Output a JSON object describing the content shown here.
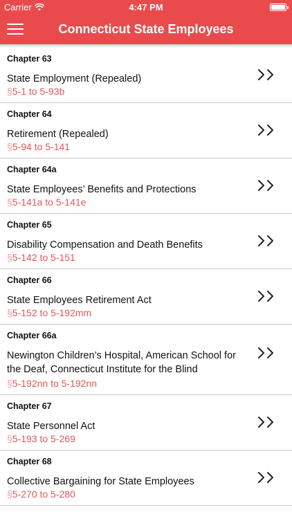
{
  "status_bar": {
    "carrier": "Carrier",
    "time": "4:47 PM"
  },
  "nav": {
    "title": "Connecticut State Employees",
    "menu_icon": "hamburger-menu-icon"
  },
  "colors": {
    "header_bg": "#e94b4d",
    "range_text": "#e0575a",
    "section_symbol": "#ef9d9f",
    "divider": "#c9c9c9"
  },
  "chapters": [
    {
      "chapter": "Chapter 63",
      "title": "State Employment (Repealed)",
      "section_symbol": "§",
      "range": "5-1 to 5-93b"
    },
    {
      "chapter": "Chapter 64",
      "title": "Retirement (Repealed)",
      "section_symbol": "§",
      "range": "5-94 to 5-141"
    },
    {
      "chapter": "Chapter 64a",
      "title": "State Employees’ Benefits and Protections",
      "section_symbol": "§",
      "range": "5-141a to 5-141e"
    },
    {
      "chapter": "Chapter 65",
      "title": "Disability Compensation and Death Benefits",
      "section_symbol": "§",
      "range": "5-142 to 5-151"
    },
    {
      "chapter": "Chapter 66",
      "title": "State Employees Retirement Act",
      "section_symbol": "§",
      "range": "5-152 to 5-192mm"
    },
    {
      "chapter": "Chapter 66a",
      "title": "Newington Children’s Hospital, American School for the Deaf, Connecticut Institute for the Blind",
      "section_symbol": "§",
      "range": "5-192nn to 5-192nn"
    },
    {
      "chapter": "Chapter 67",
      "title": "State Personnel Act",
      "section_symbol": "§",
      "range": "5-193 to 5-269"
    },
    {
      "chapter": "Chapter 68",
      "title": "Collective Bargaining for State Employees",
      "section_symbol": "§",
      "range": "5-270 to 5-280"
    }
  ]
}
